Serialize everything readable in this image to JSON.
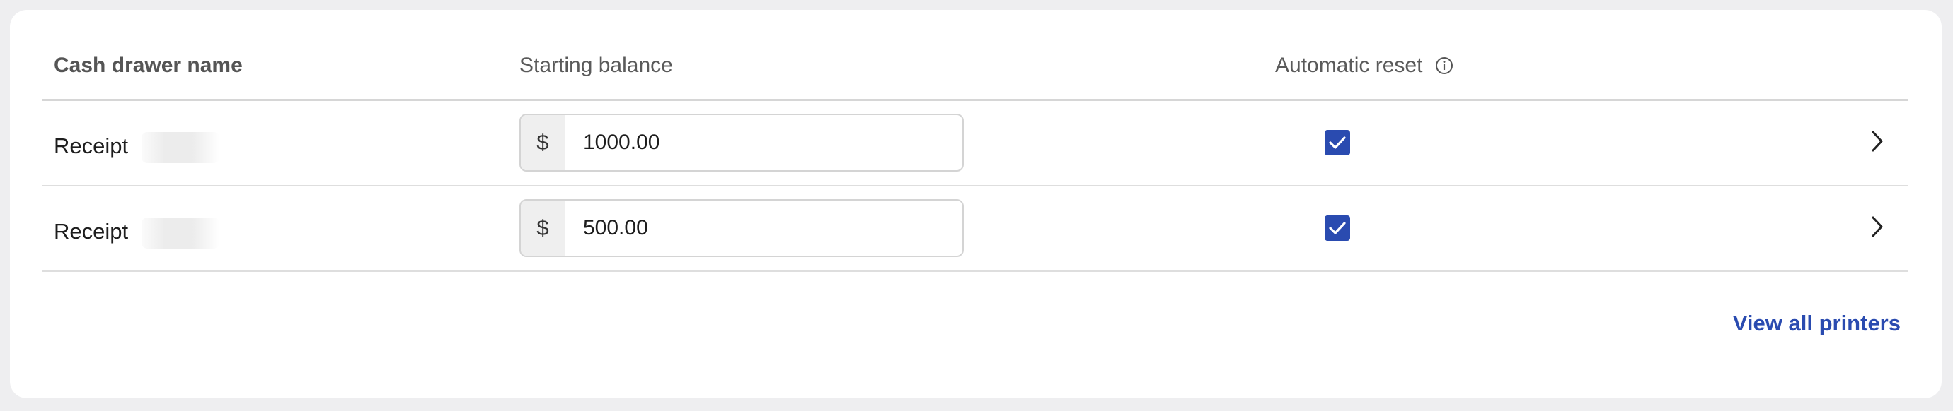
{
  "table": {
    "headers": {
      "name": "Cash drawer name",
      "balance": "Starting balance",
      "reset": "Automatic reset"
    },
    "info_icon": "info-icon",
    "rows": [
      {
        "name": "Receipt",
        "currency": "$",
        "balance": "1000.00",
        "auto_reset": true
      },
      {
        "name": "Receipt",
        "currency": "$",
        "balance": "500.00",
        "auto_reset": true
      }
    ]
  },
  "footer": {
    "link_label": "View all printers"
  },
  "colors": {
    "accent": "#2a4bb0",
    "page_bg": "#eeeef0",
    "card_bg": "#ffffff",
    "divider": "#d6d6d6"
  }
}
